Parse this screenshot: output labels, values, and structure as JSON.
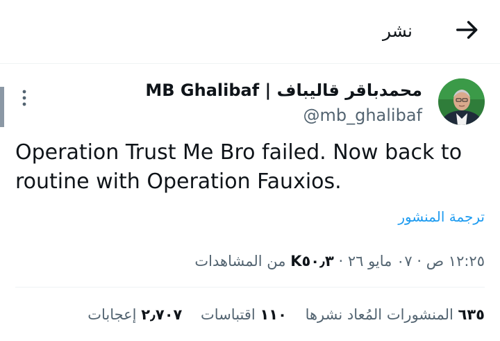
{
  "header": {
    "title": "نشر",
    "back_icon": "arrow-right-icon"
  },
  "tweet": {
    "author": {
      "display_name": "محمدباقر قالیباف | MB Ghalibaf",
      "handle": "@mb_ghalibaf",
      "avatar": "avatar-portrait"
    },
    "more_icon": "more-vertical-icon",
    "text": "Operation Trust Me Bro failed. Now back to routine with Operation Fauxios.",
    "translate_label": "ترجمة المنشور",
    "meta": {
      "time": "١٢:٢٥ ص",
      "date": "٠٧ مايو ٢٦",
      "views_count": "K٥٠٫٣",
      "views_label": "من المشاهدات",
      "separator": "·"
    },
    "stats": [
      {
        "count": "٦٣٥",
        "label": "المنشورات المُعاد نشرها"
      },
      {
        "count": "١١٠",
        "label": "اقتباسات"
      },
      {
        "count": "٢٫٧٠٧",
        "label": "إعجابات"
      }
    ]
  },
  "colors": {
    "text": "#0f1419",
    "secondary": "#536471",
    "link": "#1d9bf0",
    "divider": "#eff3f4"
  }
}
